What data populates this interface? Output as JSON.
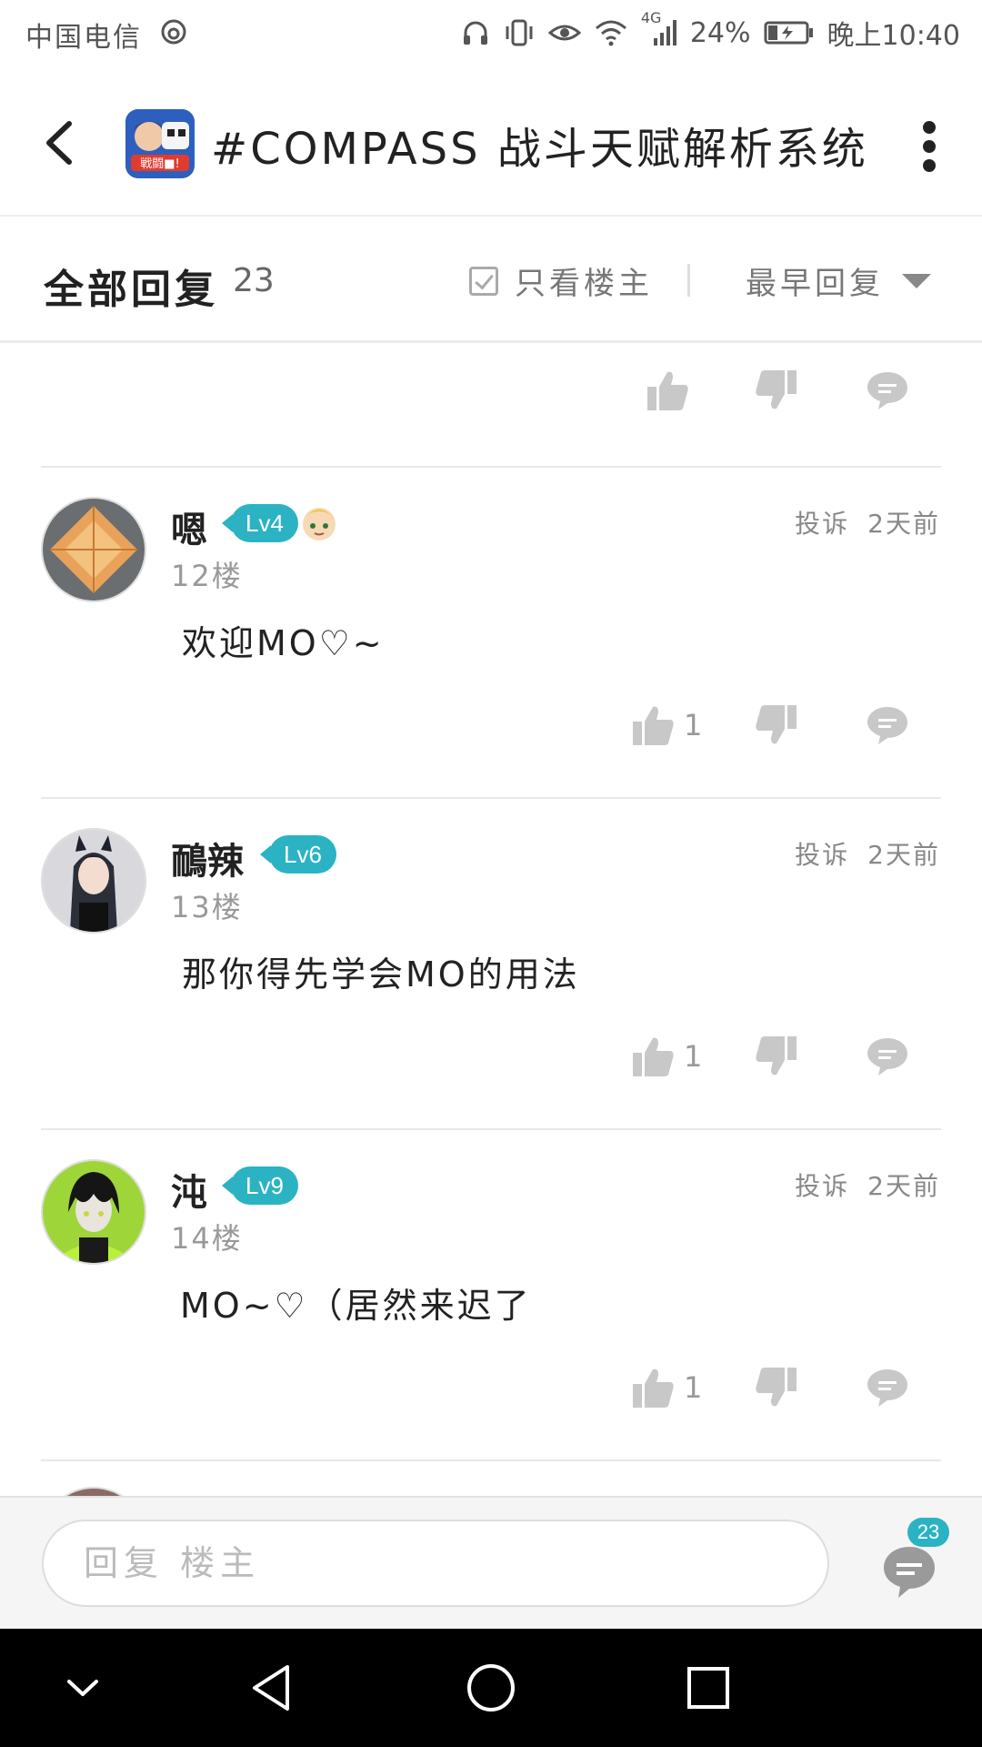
{
  "status_bar": {
    "carrier": "中国电信",
    "battery": "24%",
    "time": "晚上10:40",
    "network": "4G"
  },
  "header": {
    "title": "#COMPASS 战斗天赋解析系统",
    "game_icon_text": "戦闘■!"
  },
  "filter_bar": {
    "title": "全部回复",
    "count": "23",
    "only_op_label": "只看楼主",
    "sort_label": "最早回复"
  },
  "posts": [
    {
      "username": "嗯",
      "level": "Lv4",
      "floor": "12楼",
      "report": "投诉",
      "time": "2天前",
      "text": "欢迎MO♡~",
      "likes": "1"
    },
    {
      "username": "鴯辣",
      "level": "Lv6",
      "floor": "13楼",
      "report": "投诉",
      "time": "2天前",
      "text": "那你得先学会MO的用法",
      "likes": "1"
    },
    {
      "username": "沌",
      "level": "Lv9",
      "floor": "14楼",
      "report": "投诉",
      "time": "2天前",
      "text": "MO~♡（居然来迟了",
      "likes": "1"
    }
  ],
  "reply_bar": {
    "placeholder": "回复  楼主",
    "comment_count": "23"
  },
  "colors": {
    "accent": "#2bb3c4",
    "icon_gray": "#c8c8c8"
  }
}
